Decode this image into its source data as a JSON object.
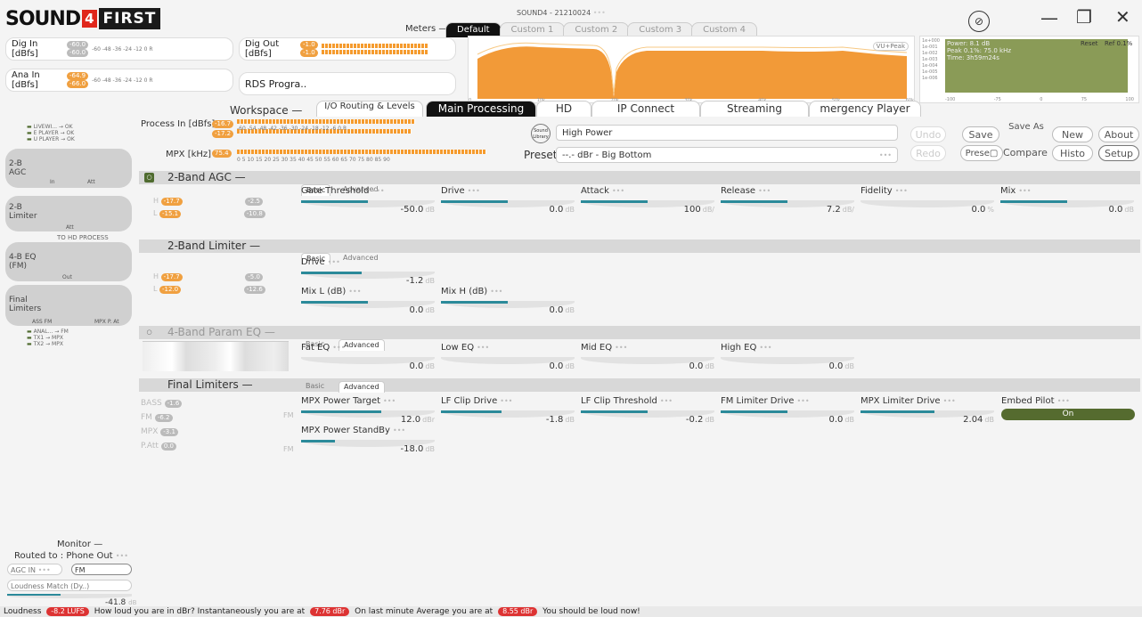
{
  "app": {
    "title": "SOUND4 - 21210024",
    "logo_part1": "SOUND",
    "logo_part2": "4",
    "logo_part3": "FIRST"
  },
  "window": {
    "minimize": "—",
    "maximize": "❐",
    "close": "✕"
  },
  "meters": {
    "dig_in": {
      "label": "Dig In [dBfs]",
      "val1": "-60.0",
      "val2": "-60.0",
      "ticks": "-60 -48 -36 -24 -12 0 R"
    },
    "ana_in": {
      "label": "Ana In [dBfs]",
      "val1": "-64.9",
      "val2": "-66.0",
      "ticks": "-60 -48 -36 -24 -12 0 R"
    },
    "dig_out": {
      "label": "Dig Out [dBfs]",
      "val1": "-1.0",
      "val2": "-1.0",
      "ticks": "-60 -48 -36 -24 -12 0 R"
    },
    "rds": {
      "label": "RDS Progra.."
    },
    "meters_label": "Meters",
    "meters_dash": "—"
  },
  "spectrum_tabs": [
    "Default",
    "Custom 1",
    "Custom 2",
    "Custom 3",
    "Custom 4"
  ],
  "spectrum": {
    "mode": "VU+Peak",
    "xlabels": [
      "0",
      "10k",
      "20k",
      "30k",
      "40k",
      "50k",
      "60k"
    ]
  },
  "mpx_panel": {
    "power": "Power: 8.1 dB",
    "peak": "Peak 0.1%: 75.0 kHz",
    "time": "Time: 3h59m24s",
    "reset": "Reset",
    "ref": "Ref 0.1%",
    "ylabels": [
      "1e+000",
      "1e-001",
      "1e-002",
      "1e-003",
      "1e-004",
      "1e-005",
      "1e-006"
    ],
    "xlabels": [
      "-100",
      "-75",
      "0",
      "75",
      "100"
    ]
  },
  "workspace": {
    "label": "Workspace",
    "dash": "—",
    "tabs": [
      "I/O Routing & Levels",
      "Main Processing",
      "HD",
      "IP Connect",
      "Streaming",
      "mergency Player"
    ]
  },
  "process": {
    "process_in_label": "Process In [dBfs]",
    "pi_v1": "-16.7",
    "pi_v2": "-17.2",
    "pi_ticks": "-60 -54 -48 -42 -36 -30 -24 -18 -12 -6 0 R",
    "mpx_label": "MPX [kHz]",
    "mpx_v": "75.4",
    "mpx_ticks": "0 5 10 15 20 25 30 35 40 45 50 55 60 65 70 75 80 85 90"
  },
  "preset": {
    "library_icon_text": "Sound Library",
    "name": "High Power",
    "label": "Preset",
    "value": "--.- dBr - Big Bottom",
    "dots": "•••"
  },
  "buttons": {
    "undo": "Undo",
    "redo": "Redo",
    "save": "Save",
    "save_as": "Save As",
    "new": "New",
    "about": "About",
    "preset": "Prese▢",
    "compare": "Compare",
    "histo": "Histo",
    "setup": "Setup"
  },
  "sidebar": {
    "status_lines": [
      "LIVEWI... → OK",
      "E PLAYER → OK",
      "U PLAYER → OK"
    ],
    "agc": {
      "title": "2-B AGC",
      "in": "In",
      "att": "Att"
    },
    "limiter": {
      "title": "2-B Limiter",
      "att": "Att"
    },
    "to_hd": "TO HD PROCESS",
    "eq": {
      "title": "4-B EQ (FM)",
      "out": "Out"
    },
    "final": {
      "title": "Final Limiters",
      "a": "ASS FM",
      "b": "MPX P. At"
    },
    "outputs": [
      "ANAL... → FM",
      "TX1 → MPX",
      "TX2 → MPX"
    ]
  },
  "sections": {
    "agc": {
      "title": "2-Band AGC",
      "dash": "—",
      "tabs": [
        "Basic",
        "Advanced"
      ],
      "h": "H",
      "h_val": "-17.7",
      "l": "L",
      "l_val": "-15.1",
      "h_att": "-2.5",
      "l_att": "-10.8",
      "params": [
        {
          "label": "Gate Threshold",
          "value": "-50.0",
          "unit": "dB",
          "level": 0.5
        },
        {
          "label": "Drive",
          "value": "0.0",
          "unit": "dB",
          "level": 0.5
        },
        {
          "label": "Attack",
          "value": "100",
          "unit": "dB/",
          "level": 0.5
        },
        {
          "label": "Release",
          "value": "7.2",
          "unit": "dB/",
          "level": 0.5
        },
        {
          "label": "Fidelity",
          "value": "0.0",
          "unit": "%",
          "level": 0.0
        },
        {
          "label": "Mix",
          "value": "0.0",
          "unit": "dB",
          "level": 0.5
        }
      ]
    },
    "limiter": {
      "title": "2-Band Limiter",
      "dash": "—",
      "tabs": [
        "Basic",
        "Advanced"
      ],
      "h": "H",
      "h_val": "-17.7",
      "l": "L",
      "l_val": "-12.0",
      "h_att": "-5.0",
      "l_att": "-12.6",
      "params": [
        {
          "label": "Drive",
          "value": "-1.2",
          "unit": "dB",
          "level": 0.45
        },
        {
          "label": "Mix L (dB)",
          "value": "0.0",
          "unit": "dB",
          "level": 0.5
        },
        {
          "label": "Mix H (dB)",
          "value": "0.0",
          "unit": "dB",
          "level": 0.5
        }
      ]
    },
    "eq": {
      "title": "4-Band Param EQ",
      "dash": "—",
      "tabs": [
        "Basic",
        "Advanced"
      ],
      "params": [
        {
          "label": "Fat EQ",
          "value": "0.0",
          "unit": "dB",
          "level": 0.0
        },
        {
          "label": "Low EQ",
          "value": "0.0",
          "unit": "dB",
          "level": 0.0
        },
        {
          "label": "Mid EQ",
          "value": "0.0",
          "unit": "dB",
          "level": 0.0
        },
        {
          "label": "High EQ",
          "value": "0.0",
          "unit": "dB",
          "level": 0.0
        }
      ]
    },
    "final": {
      "title": "Final Limiters",
      "dash": "—",
      "tabs": [
        "Basic",
        "Advanced"
      ],
      "rows": [
        {
          "label": "BASS",
          "val": "-1.6"
        },
        {
          "label": "FM",
          "val": "-6.2"
        },
        {
          "label": "MPX",
          "val": "-3.1"
        },
        {
          "label": "P.Att",
          "val": "0.0"
        }
      ],
      "fm1": "FM",
      "fm2": "FM",
      "params": [
        {
          "label": "MPX Power Target",
          "value": "12.0",
          "unit": "dBr",
          "level": 0.6
        },
        {
          "label": "LF Clip Drive",
          "value": "-1.8",
          "unit": "dB",
          "level": 0.45
        },
        {
          "label": "LF Clip Threshold",
          "value": "-0.2",
          "unit": "dB",
          "level": 0.5
        },
        {
          "label": "FM Limiter Drive",
          "value": "0.0",
          "unit": "dB",
          "level": 0.5
        },
        {
          "label": "MPX Limiter Drive",
          "value": "2.04",
          "unit": "dB",
          "level": 0.55
        },
        {
          "label": "MPX Power StandBy",
          "value": "-18.0",
          "unit": "dB",
          "level": 0.25
        }
      ],
      "embed_pilot": {
        "label": "Embed Pilot",
        "value": "On"
      }
    }
  },
  "monitor": {
    "title": "Monitor",
    "dash": "—",
    "routed": "Routed to : Phone Out",
    "agc_in": "AGC IN",
    "fm": "FM",
    "loudness_match": "Loudness Match (Dy..)",
    "value": "-41.8",
    "unit": "dB"
  },
  "status_bar": {
    "loudness": "Loudness",
    "lufs": "-8.2 LUFS",
    "t1": "How loud you are in dBr? Instantaneously you are at",
    "v1": "7.76 dBr",
    "t2": "On last minute Average you are at",
    "v2": "8.55 dBr",
    "t3": "You should be loud now!"
  }
}
